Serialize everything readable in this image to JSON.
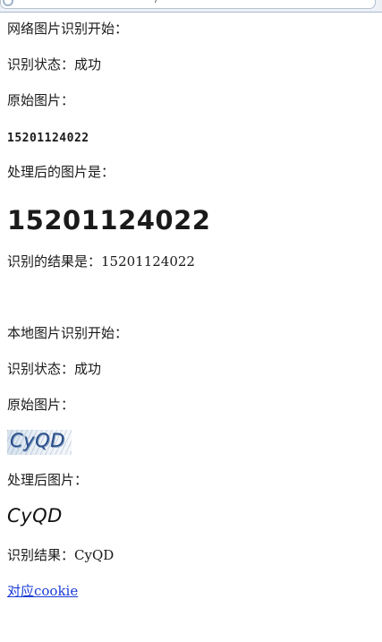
{
  "browser": {
    "address_text": "/"
  },
  "network": {
    "heading": "网络图片识别开始：",
    "status": "识别状态：成功",
    "original_label": "原始图片：",
    "original_value": "15201124022",
    "processed_label": "处理后的图片是：",
    "processed_value": "15201124022",
    "result": "识别的结果是：15201124022"
  },
  "local": {
    "heading": "本地图片识别开始：",
    "status": "识别状态：成功",
    "original_label": "原始图片：",
    "original_image_text": "CyQD",
    "processed_label": "处理后图片：",
    "processed_image_text": "CyQD",
    "result": "识别结果：CyQD"
  },
  "link": {
    "cookie": "对应cookie"
  }
}
